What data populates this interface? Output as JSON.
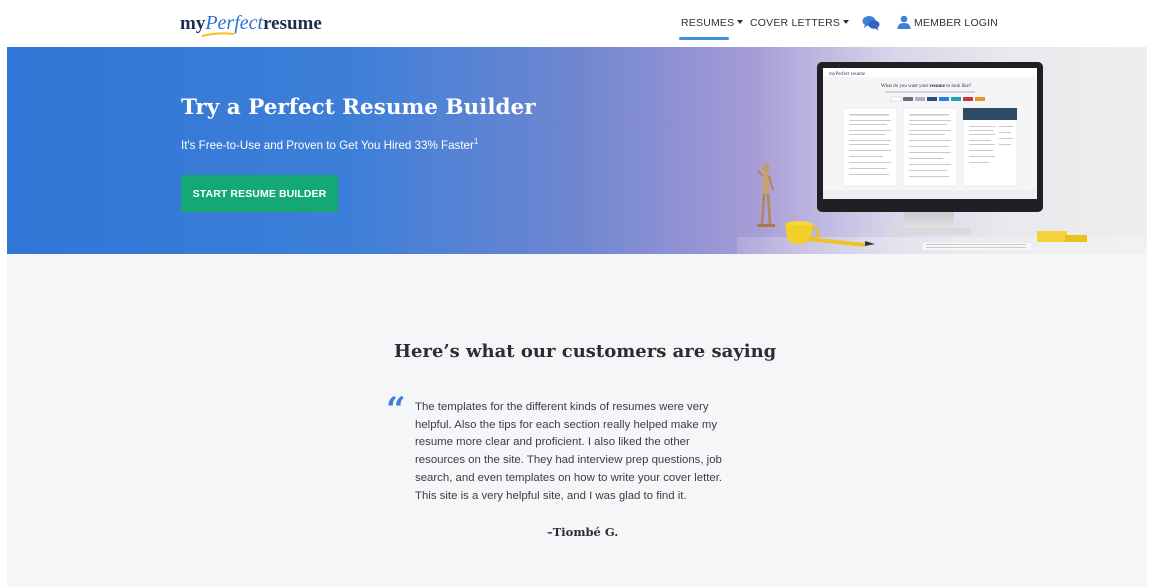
{
  "nav": {
    "logo": {
      "prefix": "my",
      "middle": "Perfect",
      "suffix": "resume"
    },
    "items": [
      {
        "label": "RESUMES"
      },
      {
        "label": "COVER LETTERS"
      }
    ],
    "login_label": "MEMBER LOGIN",
    "icons": {
      "chat": "chat-bubbles-icon",
      "user": "user-icon"
    },
    "accent": "#3d8fe0"
  },
  "hero": {
    "title": "Try a Perfect Resume Builder",
    "subtitle": "It's Free-to-Use and Proven to Get You Hired 33% Faster",
    "footnote": "1",
    "cta_label": "START RESUME BUILDER",
    "cta_color": "#13a876",
    "screen_heading_pre": "What do you want your",
    "screen_heading_bold": "resume",
    "screen_heading_post": "to look like?"
  },
  "testimonials": {
    "heading": "Here’s what our customers are saying",
    "quote_lines": [
      "The templates for the different kinds of resumes were very",
      "helpful. Also the tips for each section really helped make my",
      "resume more clear and proficient. I also liked the other",
      "resources on the site. They had interview prep questions, job",
      "search, and even templates on how to write your cover letter.",
      "This site is a very helpful site, and I was glad to find it."
    ],
    "author": "–Tiombé G.",
    "quote_color": "#3d7ed6"
  }
}
